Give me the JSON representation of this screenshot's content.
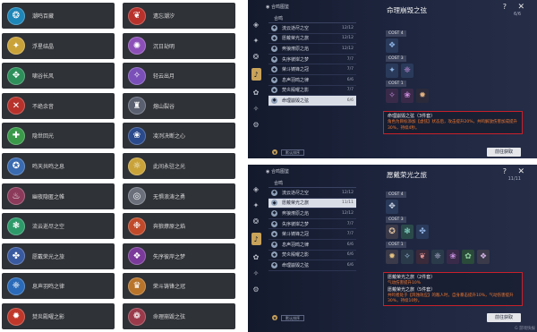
{
  "left_list": {
    "chips": [
      {
        "label": "潮鸣百藏",
        "icon": "❂",
        "color": "#1f86b8"
      },
      {
        "label": "遗忘潮汐",
        "icon": "❦",
        "color": "#b8322c"
      },
      {
        "label": "浮星结晶",
        "icon": "✦",
        "color": "#c9a33a"
      },
      {
        "label": "沉日劫明",
        "icon": "✺",
        "color": "#8c4fb8"
      },
      {
        "label": "啸谷长风",
        "icon": "✥",
        "color": "#2e8f5a"
      },
      {
        "label": "轻云出月",
        "icon": "✧",
        "color": "#7a4fb8"
      },
      {
        "label": "不绝余音",
        "icon": "✕",
        "color": "#b8322c"
      },
      {
        "label": "熔山裂谷",
        "icon": "♜",
        "color": "#5a6070"
      },
      {
        "label": "隐世回光",
        "icon": "✚",
        "color": "#3a9a4a"
      },
      {
        "label": "凌冽决断之心",
        "icon": "❀",
        "color": "#2a4a8c"
      },
      {
        "label": "鸣天共鸣之息",
        "icon": "✪",
        "color": "#3a6ab0"
      },
      {
        "label": "此间永驻之光",
        "icon": "☼",
        "color": "#c9a33a"
      },
      {
        "label": "幽夜隐匿之帷",
        "icon": "♨",
        "color": "#8c3a5a"
      },
      {
        "label": "无惧浪涛之勇",
        "icon": "◎",
        "color": "#6a6f7a"
      },
      {
        "label": "流云逝尽之空",
        "icon": "❃",
        "color": "#2e9a6a"
      },
      {
        "label": "奔狼燎原之焰",
        "icon": "❉",
        "color": "#c04a2a"
      },
      {
        "label": "愿戴荣光之旅",
        "icon": "✤",
        "color": "#3a5aa0"
      },
      {
        "label": "失序彼岸之梦",
        "icon": "❖",
        "color": "#7a3a9a"
      },
      {
        "label": "息声羽鸣之律",
        "icon": "❈",
        "color": "#2a6ab8"
      },
      {
        "label": "荣斗铸锋之冠",
        "icon": "♛",
        "color": "#b8742a"
      },
      {
        "label": "焚炎殿曜之影",
        "icon": "✹",
        "color": "#c0382a"
      },
      {
        "label": "命理崩毁之弦",
        "icon": "❁",
        "color": "#9a3a4a"
      }
    ]
  },
  "panels": [
    {
      "title": "◉ 合鸣图鉴",
      "header_label": "合鸣",
      "detail_title": "命理崩毁之弦",
      "detail_count": "6/6",
      "items": [
        {
          "name": "流云逝尽之空",
          "count": "12/12"
        },
        {
          "name": "愿戴荣光之旅",
          "count": "12/12"
        },
        {
          "name": "奔狼燎原之焰",
          "count": "12/12"
        },
        {
          "name": "失序彼岸之梦",
          "count": "7/7"
        },
        {
          "name": "荣斗铸锋之冠",
          "count": "7/7"
        },
        {
          "name": "息声羽鸣之律",
          "count": "6/6"
        },
        {
          "name": "焚炎殿曜之影",
          "count": "7/7"
        },
        {
          "name": "命理崩毁之弦",
          "count": "6/6"
        }
      ],
      "costs": [
        "COST 4",
        "COST 3",
        "COST 1"
      ],
      "desc_title": "命理崩毁之弦（3件套）",
      "desc_text": "角色为目标添加【虚弦】状态后，攻击提升20%，共鸣解放伤害加成提升30%，持续4秒。",
      "footer_sort": "默认排序",
      "button": "前往获取"
    },
    {
      "title": "◉ 合鸣图鉴",
      "header_label": "合鸣",
      "detail_title": "愿戴荣光之旅",
      "detail_count": "11/11",
      "items": [
        {
          "name": "流云逝尽之空",
          "count": "12/12"
        },
        {
          "name": "愿戴荣光之旅",
          "count": "11/11"
        },
        {
          "name": "奔狼燎原之焰",
          "count": "12/12"
        },
        {
          "name": "失序彼岸之梦",
          "count": "7/7"
        },
        {
          "name": "荣斗铸锋之冠",
          "count": "7/7"
        },
        {
          "name": "息声羽鸣之律",
          "count": "6/6"
        },
        {
          "name": "焚炎殿曜之影",
          "count": "6/6"
        },
        {
          "name": "命理崩毁之弦",
          "count": "6/6"
        }
      ],
      "costs": [
        "COST 4",
        "COST 3",
        "COST 1"
      ],
      "desc_title": "愿戴荣光之旅（2件套）",
      "desc_text": "气动伤害提升10%",
      "desc_title2": "愿戴荣光之旅（5件套）",
      "desc_text2": "共鸣者处于【风蚀效应】的敌人时，自身暴击提升10%，气动伤害提升30%，持续10秒。",
      "footer_sort": "默认排序",
      "button": "前往获取"
    }
  ],
  "watermark": "G 游戏快报"
}
